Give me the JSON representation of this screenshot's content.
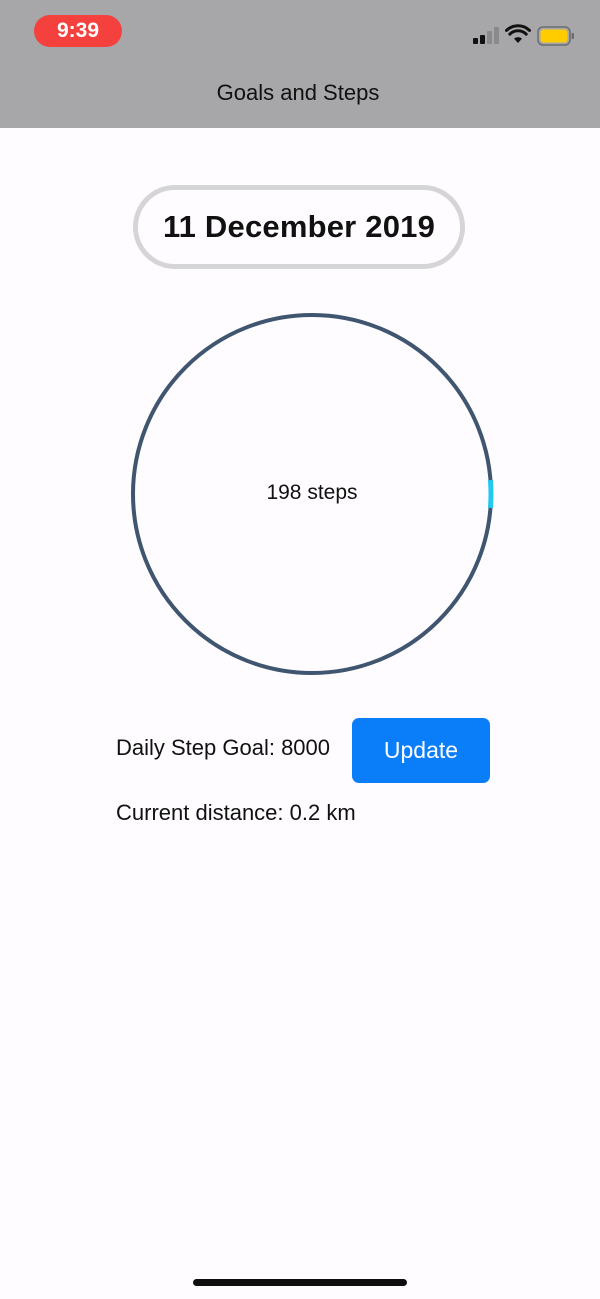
{
  "status_bar": {
    "time": "9:39",
    "time_pill_color": "#f4413e",
    "icons": [
      "signal-icon",
      "wifi-icon",
      "battery-icon"
    ]
  },
  "nav": {
    "title": "Goals and Steps"
  },
  "date": {
    "label": "11 December 2019"
  },
  "progress": {
    "steps_text": "198 steps",
    "steps": 198,
    "goal": 8000,
    "ring_color": "#3f5570",
    "progress_color": "#22c8f0"
  },
  "goal_row": {
    "label": "Daily Step Goal: 8000",
    "button_label": "Update",
    "button_color": "#0a7df9"
  },
  "distance": {
    "label": "Current distance: 0.2 km"
  }
}
